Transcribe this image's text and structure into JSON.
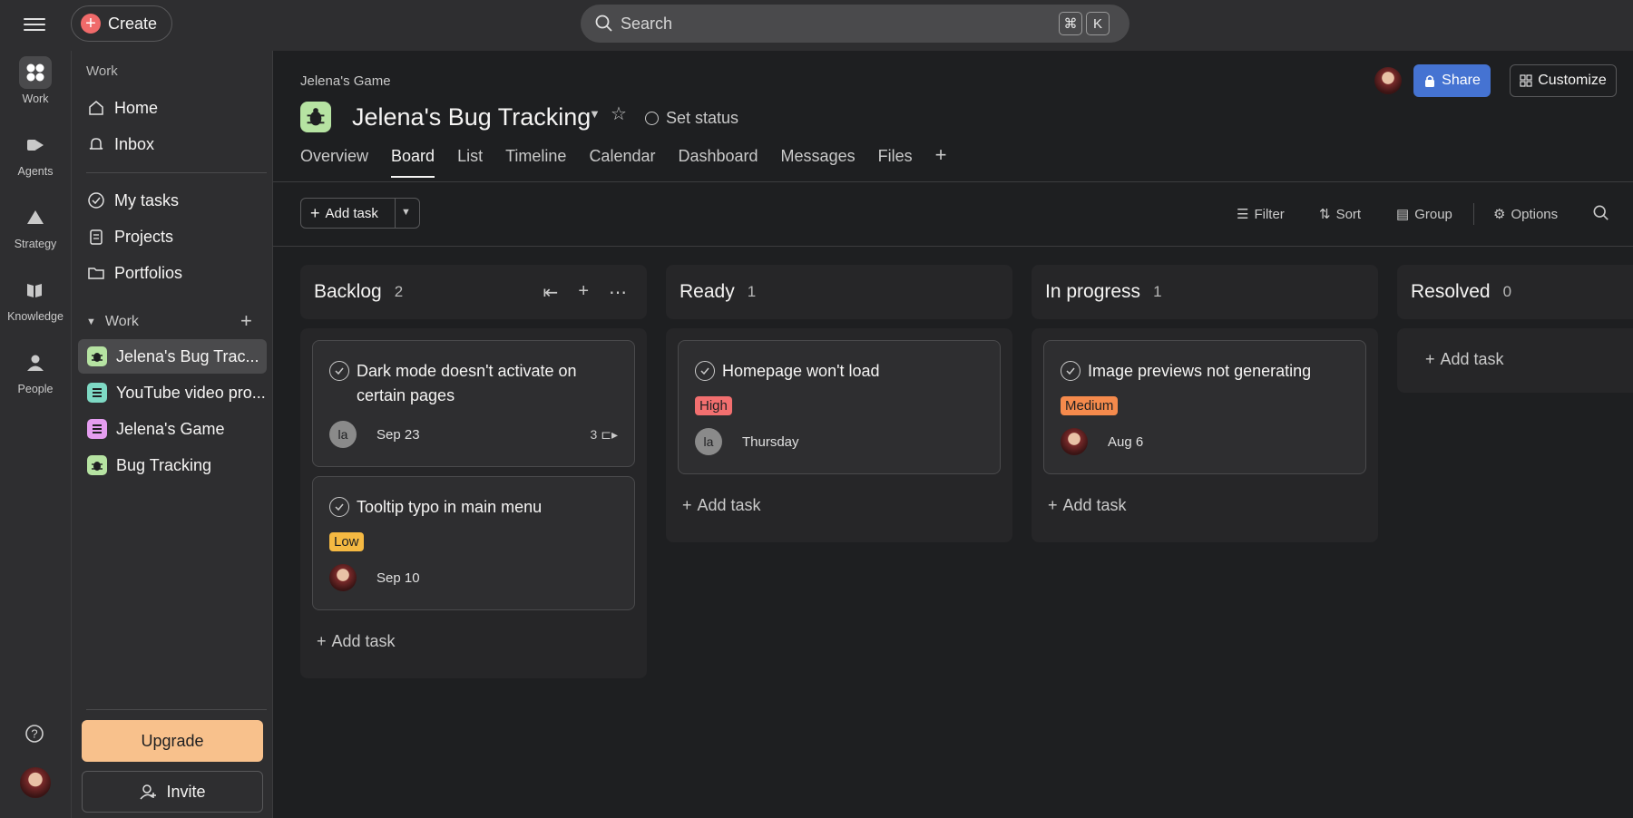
{
  "topbar": {
    "create_label": "Create",
    "search_placeholder": "Search",
    "kbd_cmd": "⌘",
    "kbd_k": "K"
  },
  "rail": [
    {
      "label": "Work",
      "icon": "work-icon"
    },
    {
      "label": "Agents",
      "icon": "agents-icon"
    },
    {
      "label": "Strategy",
      "icon": "strategy-icon"
    },
    {
      "label": "Knowledge",
      "icon": "knowledge-icon"
    },
    {
      "label": "People",
      "icon": "people-icon"
    }
  ],
  "sidebar": {
    "header": "Work",
    "home": "Home",
    "inbox": "Inbox",
    "my_tasks": "My tasks",
    "projects": "Projects",
    "portfolios": "Portfolios",
    "work_section": "Work",
    "items": [
      {
        "label": "Jelena's Bug Trac...",
        "color": "#b6e3a2"
      },
      {
        "label": "YouTube video pro...",
        "color": "#7ed9c4"
      },
      {
        "label": "Jelena's Game",
        "color": "#e59df0"
      },
      {
        "label": "Bug Tracking",
        "color": "#b6e3a2"
      }
    ],
    "upgrade": "Upgrade",
    "invite": "Invite"
  },
  "header": {
    "crumb": "Jelena's Game",
    "title": "Jelena's Bug Tracking",
    "set_status": "Set status",
    "share": "Share",
    "customize": "Customize",
    "tabs": [
      "Overview",
      "Board",
      "List",
      "Timeline",
      "Calendar",
      "Dashboard",
      "Messages",
      "Files"
    ]
  },
  "toolbar": {
    "add_task": "Add task",
    "filter": "Filter",
    "sort": "Sort",
    "group": "Group",
    "options": "Options"
  },
  "columns": [
    {
      "name": "Backlog",
      "count": "2"
    },
    {
      "name": "Ready",
      "count": "1"
    },
    {
      "name": "In progress",
      "count": "1"
    },
    {
      "name": "Resolved",
      "count": "0"
    }
  ],
  "cards": {
    "c1": {
      "title": "Dark mode doesn't activate on certain pages",
      "avatar": "la",
      "date": "Sep 23",
      "subtasks": "3"
    },
    "c2": {
      "title": "Tooltip typo in main menu",
      "tag": "Low",
      "date": "Sep 10"
    },
    "c3": {
      "title": "Homepage won't load",
      "tag": "High",
      "avatar": "la",
      "date": "Thursday"
    },
    "c4": {
      "title": "Image previews not generating",
      "tag": "Medium",
      "date": "Aug 6"
    }
  },
  "add_task": "Add task",
  "colors": {
    "high": "#f26f6f",
    "low": "#f5b942",
    "medium": "#f58a4c",
    "share": "#4573d2",
    "upgrade": "#f8c18c"
  }
}
